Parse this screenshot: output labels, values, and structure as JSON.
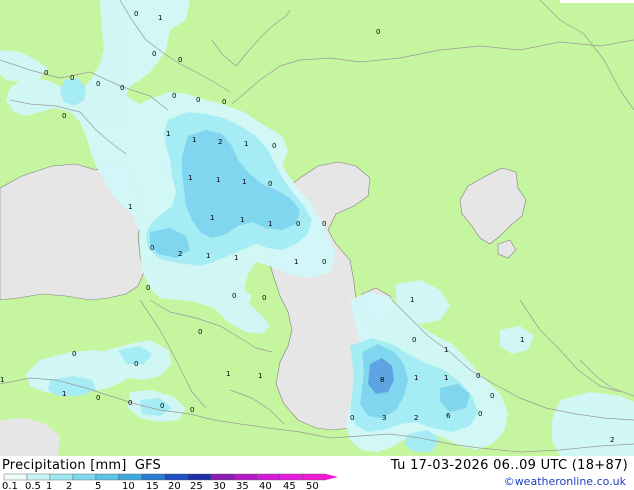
{
  "header": {
    "title": "Precipitation [mm]",
    "model": "GFS",
    "valid_time": "Tu 17-03-2026 06..09 UTC (18+87)"
  },
  "credit": "©weatheronline.co.uk",
  "legend": {
    "values": [
      "0.1",
      "0.5",
      "1",
      "2",
      "5",
      "10",
      "15",
      "20",
      "25",
      "30",
      "35",
      "40",
      "45",
      "50"
    ],
    "colors": [
      "#f0fcfc",
      "#c8f4f8",
      "#9ee8f4",
      "#7fd8ee",
      "#5cc4e6",
      "#3ea8dc",
      "#2a7ed0",
      "#1f4fc0",
      "#1a2fa8",
      "#8c1ab4",
      "#b41ac8",
      "#d21ad8",
      "#e81ae0",
      "#f01ad0"
    ]
  },
  "colors": {
    "land": "#c6f5a0",
    "water": "#e6e6e6",
    "precip_light": "#d2f8fa",
    "precip_low": "#a6ecf4",
    "precip_mid": "#7fd6ee",
    "precip_high": "#5fa4e2",
    "border": "#9a9a9a",
    "coast": "#808080"
  },
  "map_labels": [
    {
      "text": "0"
    },
    {
      "text": "1"
    },
    {
      "text": "0"
    },
    {
      "text": "0"
    },
    {
      "text": "0"
    },
    {
      "text": "0"
    },
    {
      "text": "0"
    },
    {
      "text": "0"
    },
    {
      "text": "0"
    },
    {
      "text": "0"
    },
    {
      "text": "0"
    },
    {
      "text": "0"
    },
    {
      "text": "0"
    },
    {
      "text": "1"
    },
    {
      "text": "2"
    },
    {
      "text": "1"
    },
    {
      "text": "0"
    },
    {
      "text": "1"
    },
    {
      "text": "1"
    },
    {
      "text": "1"
    },
    {
      "text": "1"
    },
    {
      "text": "0"
    },
    {
      "text": "1"
    },
    {
      "text": "1"
    },
    {
      "text": "1"
    },
    {
      "text": "1"
    },
    {
      "text": "0"
    },
    {
      "text": "2"
    },
    {
      "text": "1"
    },
    {
      "text": "1"
    },
    {
      "text": "1"
    },
    {
      "text": "0"
    },
    {
      "text": "0"
    },
    {
      "text": "0"
    },
    {
      "text": "0"
    },
    {
      "text": "0"
    },
    {
      "text": "0"
    },
    {
      "text": "0"
    },
    {
      "text": "0"
    },
    {
      "text": "0"
    },
    {
      "text": "1"
    },
    {
      "text": "1"
    },
    {
      "text": "0"
    },
    {
      "text": "0"
    },
    {
      "text": "0"
    },
    {
      "text": "0"
    },
    {
      "text": "1"
    },
    {
      "text": "1"
    },
    {
      "text": "1"
    },
    {
      "text": "0"
    },
    {
      "text": "8"
    },
    {
      "text": "1"
    },
    {
      "text": "1"
    },
    {
      "text": "0"
    },
    {
      "text": "0"
    },
    {
      "text": "3"
    },
    {
      "text": "2"
    },
    {
      "text": "6"
    },
    {
      "text": "0"
    },
    {
      "text": "0"
    },
    {
      "text": "2"
    },
    {
      "text": "1"
    },
    {
      "text": "1"
    }
  ]
}
